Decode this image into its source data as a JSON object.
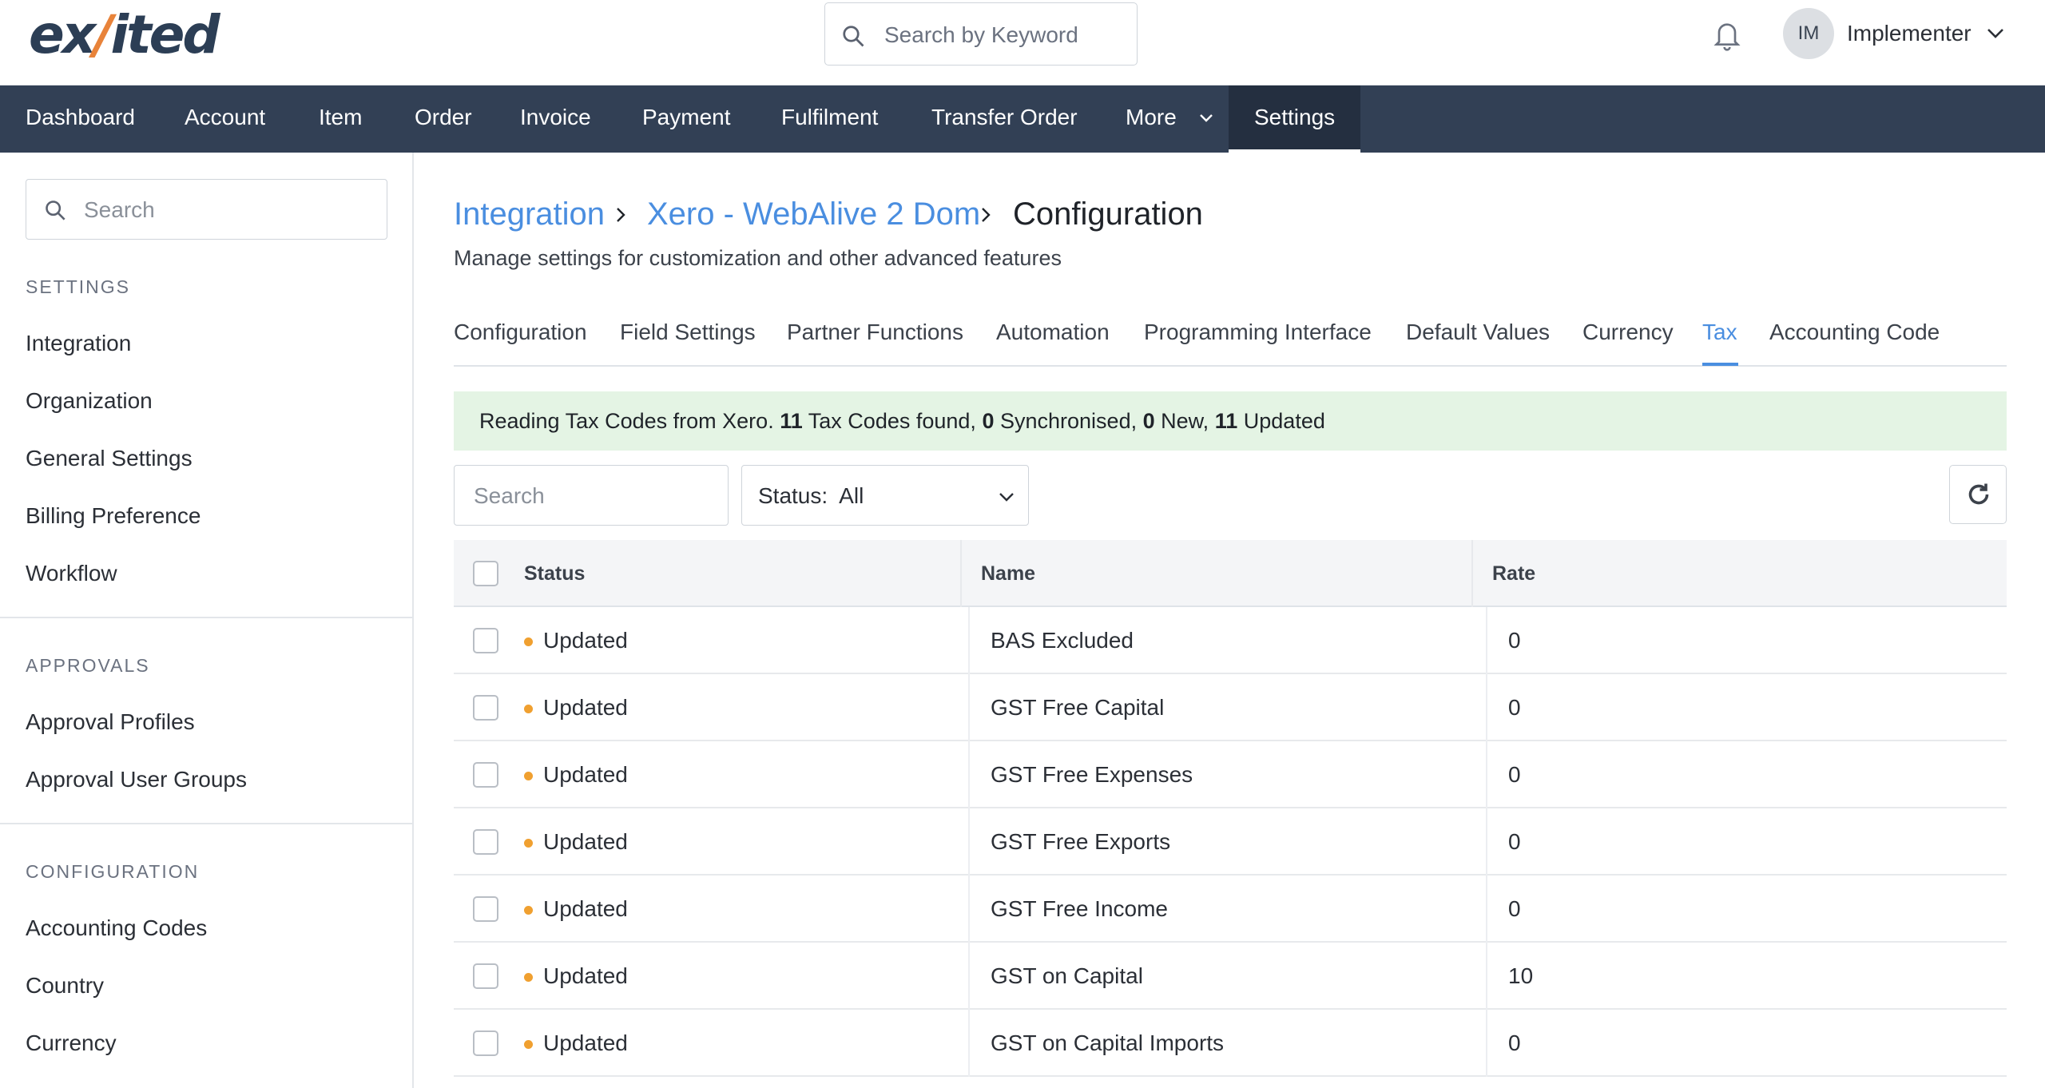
{
  "header": {
    "logo_text": "exited",
    "search_placeholder": "Search by Keyword",
    "user_initials": "IM",
    "user_name": "Implementer"
  },
  "nav": {
    "items": [
      "Dashboard",
      "Account",
      "Item",
      "Order",
      "Invoice",
      "Payment",
      "Fulfilment",
      "Transfer Order",
      "More",
      "Settings"
    ],
    "active": "Settings"
  },
  "sidebar": {
    "search_placeholder": "Search",
    "sections": [
      {
        "title": "SETTINGS",
        "items": [
          "Integration",
          "Organization",
          "General Settings",
          "Billing Preference",
          "Workflow"
        ]
      },
      {
        "title": "APPROVALS",
        "items": [
          "Approval Profiles",
          "Approval User Groups"
        ]
      },
      {
        "title": "CONFIGURATION",
        "items": [
          "Accounting Codes",
          "Country",
          "Currency"
        ]
      }
    ]
  },
  "breadcrumb": {
    "items": [
      "Integration",
      "Xero - WebAlive 2 Dom",
      "Configuration"
    ]
  },
  "subtitle": "Manage settings for customization and other advanced features",
  "tabs": {
    "items": [
      "Configuration",
      "Field Settings",
      "Partner Functions",
      "Automation",
      "Programming Interface",
      "Default Values",
      "Currency",
      "Tax",
      "Accounting Code"
    ],
    "active": "Tax"
  },
  "alert": {
    "prefix": "Reading Tax Codes from Xero.",
    "found_count": "11",
    "found_label": "Tax Codes found,",
    "sync_count": "0",
    "sync_label": "Synchronised,",
    "new_count": "0",
    "new_label": "New,",
    "updated_count": "11",
    "updated_label": "Updated"
  },
  "filters": {
    "search_placeholder": "Search",
    "status_label": "Status:  All"
  },
  "table": {
    "columns": [
      "Status",
      "Name",
      "Rate"
    ],
    "rows": [
      {
        "status": "Updated",
        "name": "BAS Excluded",
        "rate": "0"
      },
      {
        "status": "Updated",
        "name": "GST Free Capital",
        "rate": "0"
      },
      {
        "status": "Updated",
        "name": "GST Free Expenses",
        "rate": "0"
      },
      {
        "status": "Updated",
        "name": "GST Free Exports",
        "rate": "0"
      },
      {
        "status": "Updated",
        "name": "GST Free Income",
        "rate": "0"
      },
      {
        "status": "Updated",
        "name": "GST on Capital",
        "rate": "10"
      },
      {
        "status": "Updated",
        "name": "GST on Capital Imports",
        "rate": "0"
      }
    ]
  },
  "colors": {
    "nav_bg": "#324055",
    "accent_link": "#4a8ee0",
    "alert_bg": "#e4f4e4",
    "status_dot": "#f0a030"
  }
}
